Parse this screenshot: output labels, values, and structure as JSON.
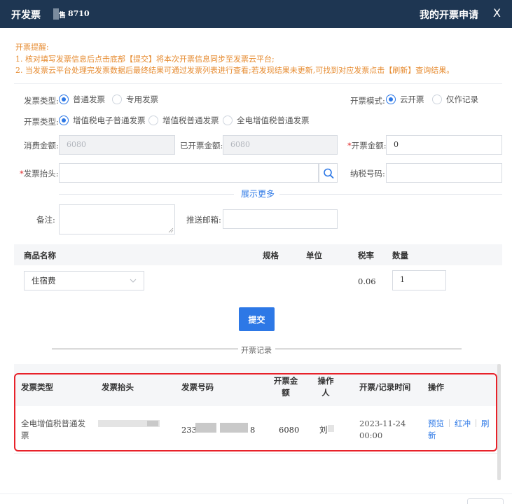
{
  "header": {
    "title": "开发票",
    "masked_char": "售",
    "code": "8710",
    "my_requests": "我的开票申请",
    "close": "X"
  },
  "notice": {
    "title": "开票提醒:",
    "line1": "1. 核对填写发票信息后点击底部【提交】将本次开票信息同步至发票云平台;",
    "line2": "2. 当发票云平台处理完发票数据后最终结果可通过发票列表进行查看;若发现结果未更新,可找到对应发票点击【刷新】查询结果。"
  },
  "form": {
    "invoice_type_label": "发票类型:",
    "invoice_type_options": [
      "普通发票",
      "专用发票"
    ],
    "invoice_mode_label": "开票模式:",
    "invoice_mode_options": [
      "云开票",
      "仅作记录"
    ],
    "issue_type_label": "开票类型:",
    "issue_type_options": [
      "增值税电子普通发票",
      "增值税普通发票",
      "全电增值税普通发票"
    ],
    "consume_amount_label": "消费金额:",
    "consume_amount_value": "6080",
    "issued_amount_label": "已开票金额:",
    "issued_amount_value": "6080",
    "invoice_amount_label": "开票金额:",
    "invoice_amount_value": "0",
    "buyer_title_label": "发票抬头:",
    "buyer_title_value": "",
    "tax_id_label": "纳税号码:",
    "tax_id_value": "",
    "required_mark": "*",
    "show_more": "展示更多",
    "remark_label": "备注:",
    "email_label": "推送邮箱:",
    "email_value": ""
  },
  "products": {
    "headers": {
      "name": "商品名称",
      "spec": "规格",
      "unit": "单位",
      "tax_rate": "税率",
      "qty": "数量"
    },
    "row": {
      "name": "住宿费",
      "tax_rate": "0.06",
      "qty": "1"
    }
  },
  "submit_label": "提交",
  "records": {
    "title": "开票记录",
    "headers": {
      "type": "发票类型",
      "buyer": "发票抬头",
      "number": "发票号码",
      "amount_line1": "开票金",
      "amount_line2": "额",
      "operator_line1": "操作",
      "operator_line2": "人",
      "time": "开票/记录时间",
      "action": "操作"
    },
    "row": {
      "type_line1": "全电增值税普通发",
      "type_line2": "票",
      "number_prefix": "233",
      "number_suffix": "8",
      "amount": "6080",
      "operator_visible": "刘",
      "date": "2023-11-24",
      "time": "00:00",
      "actions": {
        "preview": "预览",
        "red": "红冲",
        "refresh_line1": "刷",
        "refresh_line2": "新"
      }
    }
  },
  "colors": {
    "header_bg": "#1e3652",
    "primary": "#2d78e6",
    "notice": "#e68a2e",
    "required": "#e02929",
    "highlight_box": "#e8222a"
  }
}
